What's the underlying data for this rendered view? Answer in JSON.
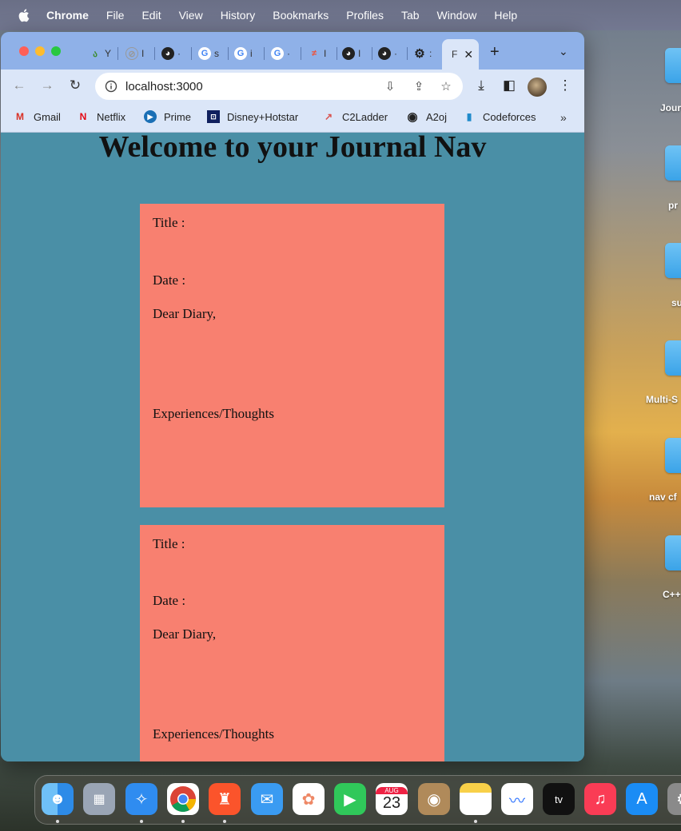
{
  "menubar": {
    "app": "Chrome",
    "items": [
      "File",
      "Edit",
      "View",
      "History",
      "Bookmarks",
      "Profiles",
      "Tab",
      "Window",
      "Help"
    ]
  },
  "browser": {
    "tabs": [
      {
        "label": "Y",
        "icon": "lime-icon",
        "color": "#3c8c2e"
      },
      {
        "label": "I",
        "icon": "disabled-icon",
        "color": "#999999"
      },
      {
        "label": "·",
        "icon": "github-icon",
        "color": "#222222"
      },
      {
        "label": "s",
        "icon": "google-icon",
        "color": "#4285f4"
      },
      {
        "label": "i",
        "icon": "google-icon",
        "color": "#4285f4"
      },
      {
        "label": "·",
        "icon": "google-icon",
        "color": "#4285f4"
      },
      {
        "label": "I",
        "icon": "swift-icon",
        "color": "#f05138"
      },
      {
        "label": "I",
        "icon": "github-icon",
        "color": "#222222"
      },
      {
        "label": "·",
        "icon": "github-icon",
        "color": "#222222"
      },
      {
        "label": ":",
        "icon": "gear-icon",
        "color": "#222222"
      }
    ],
    "active_tab": {
      "label": "F",
      "close": "✕"
    },
    "new_tab": "+",
    "url": "localhost:3000"
  },
  "bookmarks": [
    {
      "label": "Gmail",
      "icon": "gmail-icon",
      "glyph": "M",
      "color": "#d93025"
    },
    {
      "label": "Netflix",
      "icon": "netflix-icon",
      "glyph": "N",
      "color": "#e50914"
    },
    {
      "label": "Prime",
      "icon": "prime-video-icon",
      "glyph": "▶",
      "color": "#1a6fb5"
    },
    {
      "label": "Disney+Hotstar",
      "icon": "hotstar-icon",
      "glyph": "⊡",
      "color": "#10205e"
    },
    {
      "label": "C2Ladder",
      "icon": "c2ladder-icon",
      "glyph": "↗",
      "color": "#d9534f"
    },
    {
      "label": "A2oj",
      "icon": "globe-icon",
      "glyph": "◉",
      "color": "#222222"
    },
    {
      "label": "Codeforces",
      "icon": "codeforces-icon",
      "glyph": "▮",
      "color": "#1f8acb"
    }
  ],
  "bookmarks_more": "»",
  "page": {
    "title": "Welcome to your Journal Nav",
    "entries": [
      {
        "title_label": "Title :",
        "date_label": "Date :",
        "greeting": "Dear Diary,",
        "body_label": "Experiences/Thoughts"
      },
      {
        "title_label": "Title :",
        "date_label": "Date :",
        "greeting": "Dear Diary,",
        "body_label": "Experiences/Thoughts"
      }
    ]
  },
  "desktop": {
    "folders": [
      "Jour",
      "pr",
      "su",
      "Multi-S",
      "nav cf",
      "C++"
    ]
  },
  "dock": {
    "calendar_month": "AUG",
    "calendar_day": "23",
    "apps": [
      {
        "name": "finder",
        "color": "#3c9cf0"
      },
      {
        "name": "launchpad",
        "color": "#9aa5b5"
      },
      {
        "name": "safari",
        "color": "#2f8cf0"
      },
      {
        "name": "chrome",
        "color": "#ffffff"
      },
      {
        "name": "brave",
        "color": "#fb542b"
      },
      {
        "name": "mail",
        "color": "#3a9bf2"
      },
      {
        "name": "photos",
        "color": "#ffffff"
      },
      {
        "name": "facetime",
        "color": "#30c85a"
      },
      {
        "name": "calendar",
        "color": "#ffffff"
      },
      {
        "name": "contacts",
        "color": "#b08a5a"
      },
      {
        "name": "notes",
        "color": "#ffffff"
      },
      {
        "name": "freeform",
        "color": "#ffffff"
      },
      {
        "name": "tv",
        "color": "#111111"
      },
      {
        "name": "music",
        "color": "#fa3c55"
      },
      {
        "name": "app-store",
        "color": "#1a8cf5"
      },
      {
        "name": "settings",
        "color": "#8a8a8a"
      }
    ]
  }
}
